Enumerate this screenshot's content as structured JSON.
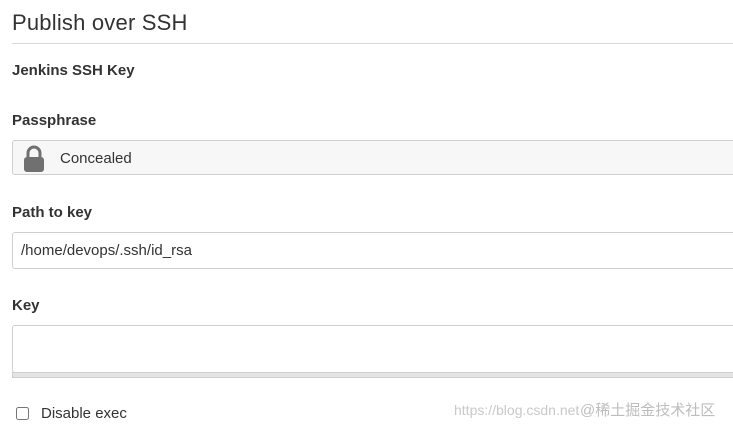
{
  "section": {
    "title": "Publish over SSH"
  },
  "fields": {
    "jenkins_ssh_key_label": "Jenkins SSH Key",
    "passphrase": {
      "label": "Passphrase",
      "value": "Concealed"
    },
    "path_to_key": {
      "label": "Path to key",
      "value": "/home/devops/.ssh/id_rsa"
    },
    "key": {
      "label": "Key",
      "value": ""
    }
  },
  "options": {
    "disable_exec": {
      "label": "Disable exec",
      "checked": false
    }
  },
  "watermark": {
    "url": "https://blog.csdn.net",
    "brand": "@稀土掘金技术社区"
  },
  "icons": {
    "passphrase_lock": "lock-icon",
    "lock_color": "#707070"
  }
}
